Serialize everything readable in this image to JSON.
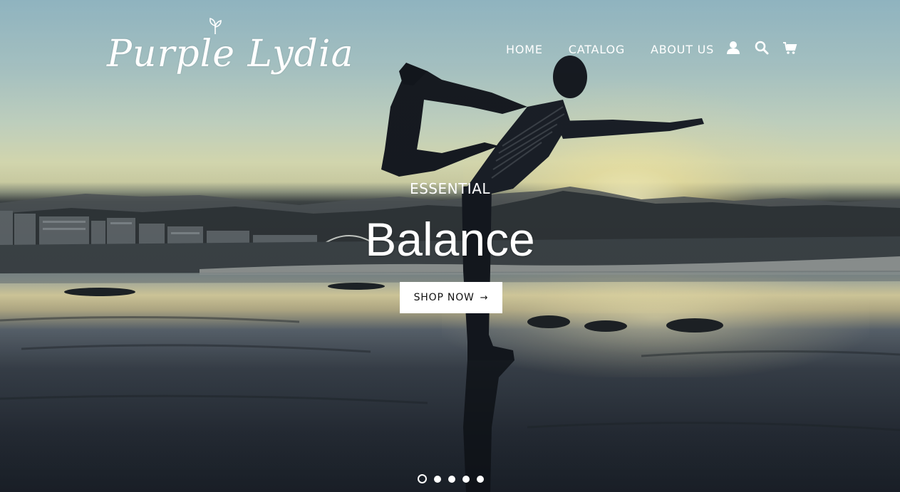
{
  "brand": {
    "name": "Purple Lydia"
  },
  "nav": {
    "items": [
      {
        "label": "HOME"
      },
      {
        "label": "CATALOG"
      },
      {
        "label": "ABOUT US"
      }
    ],
    "icons": [
      "account-icon",
      "search-icon",
      "cart-icon"
    ]
  },
  "hero": {
    "subtitle": "ESSENTIAL",
    "title": "Balance",
    "button_label": "SHOP NOW",
    "button_arrow": "→",
    "slides_total": 5,
    "active_slide": 1
  },
  "colors": {
    "text": "#ffffff",
    "button_bg": "#ffffff",
    "button_text": "#111111"
  }
}
